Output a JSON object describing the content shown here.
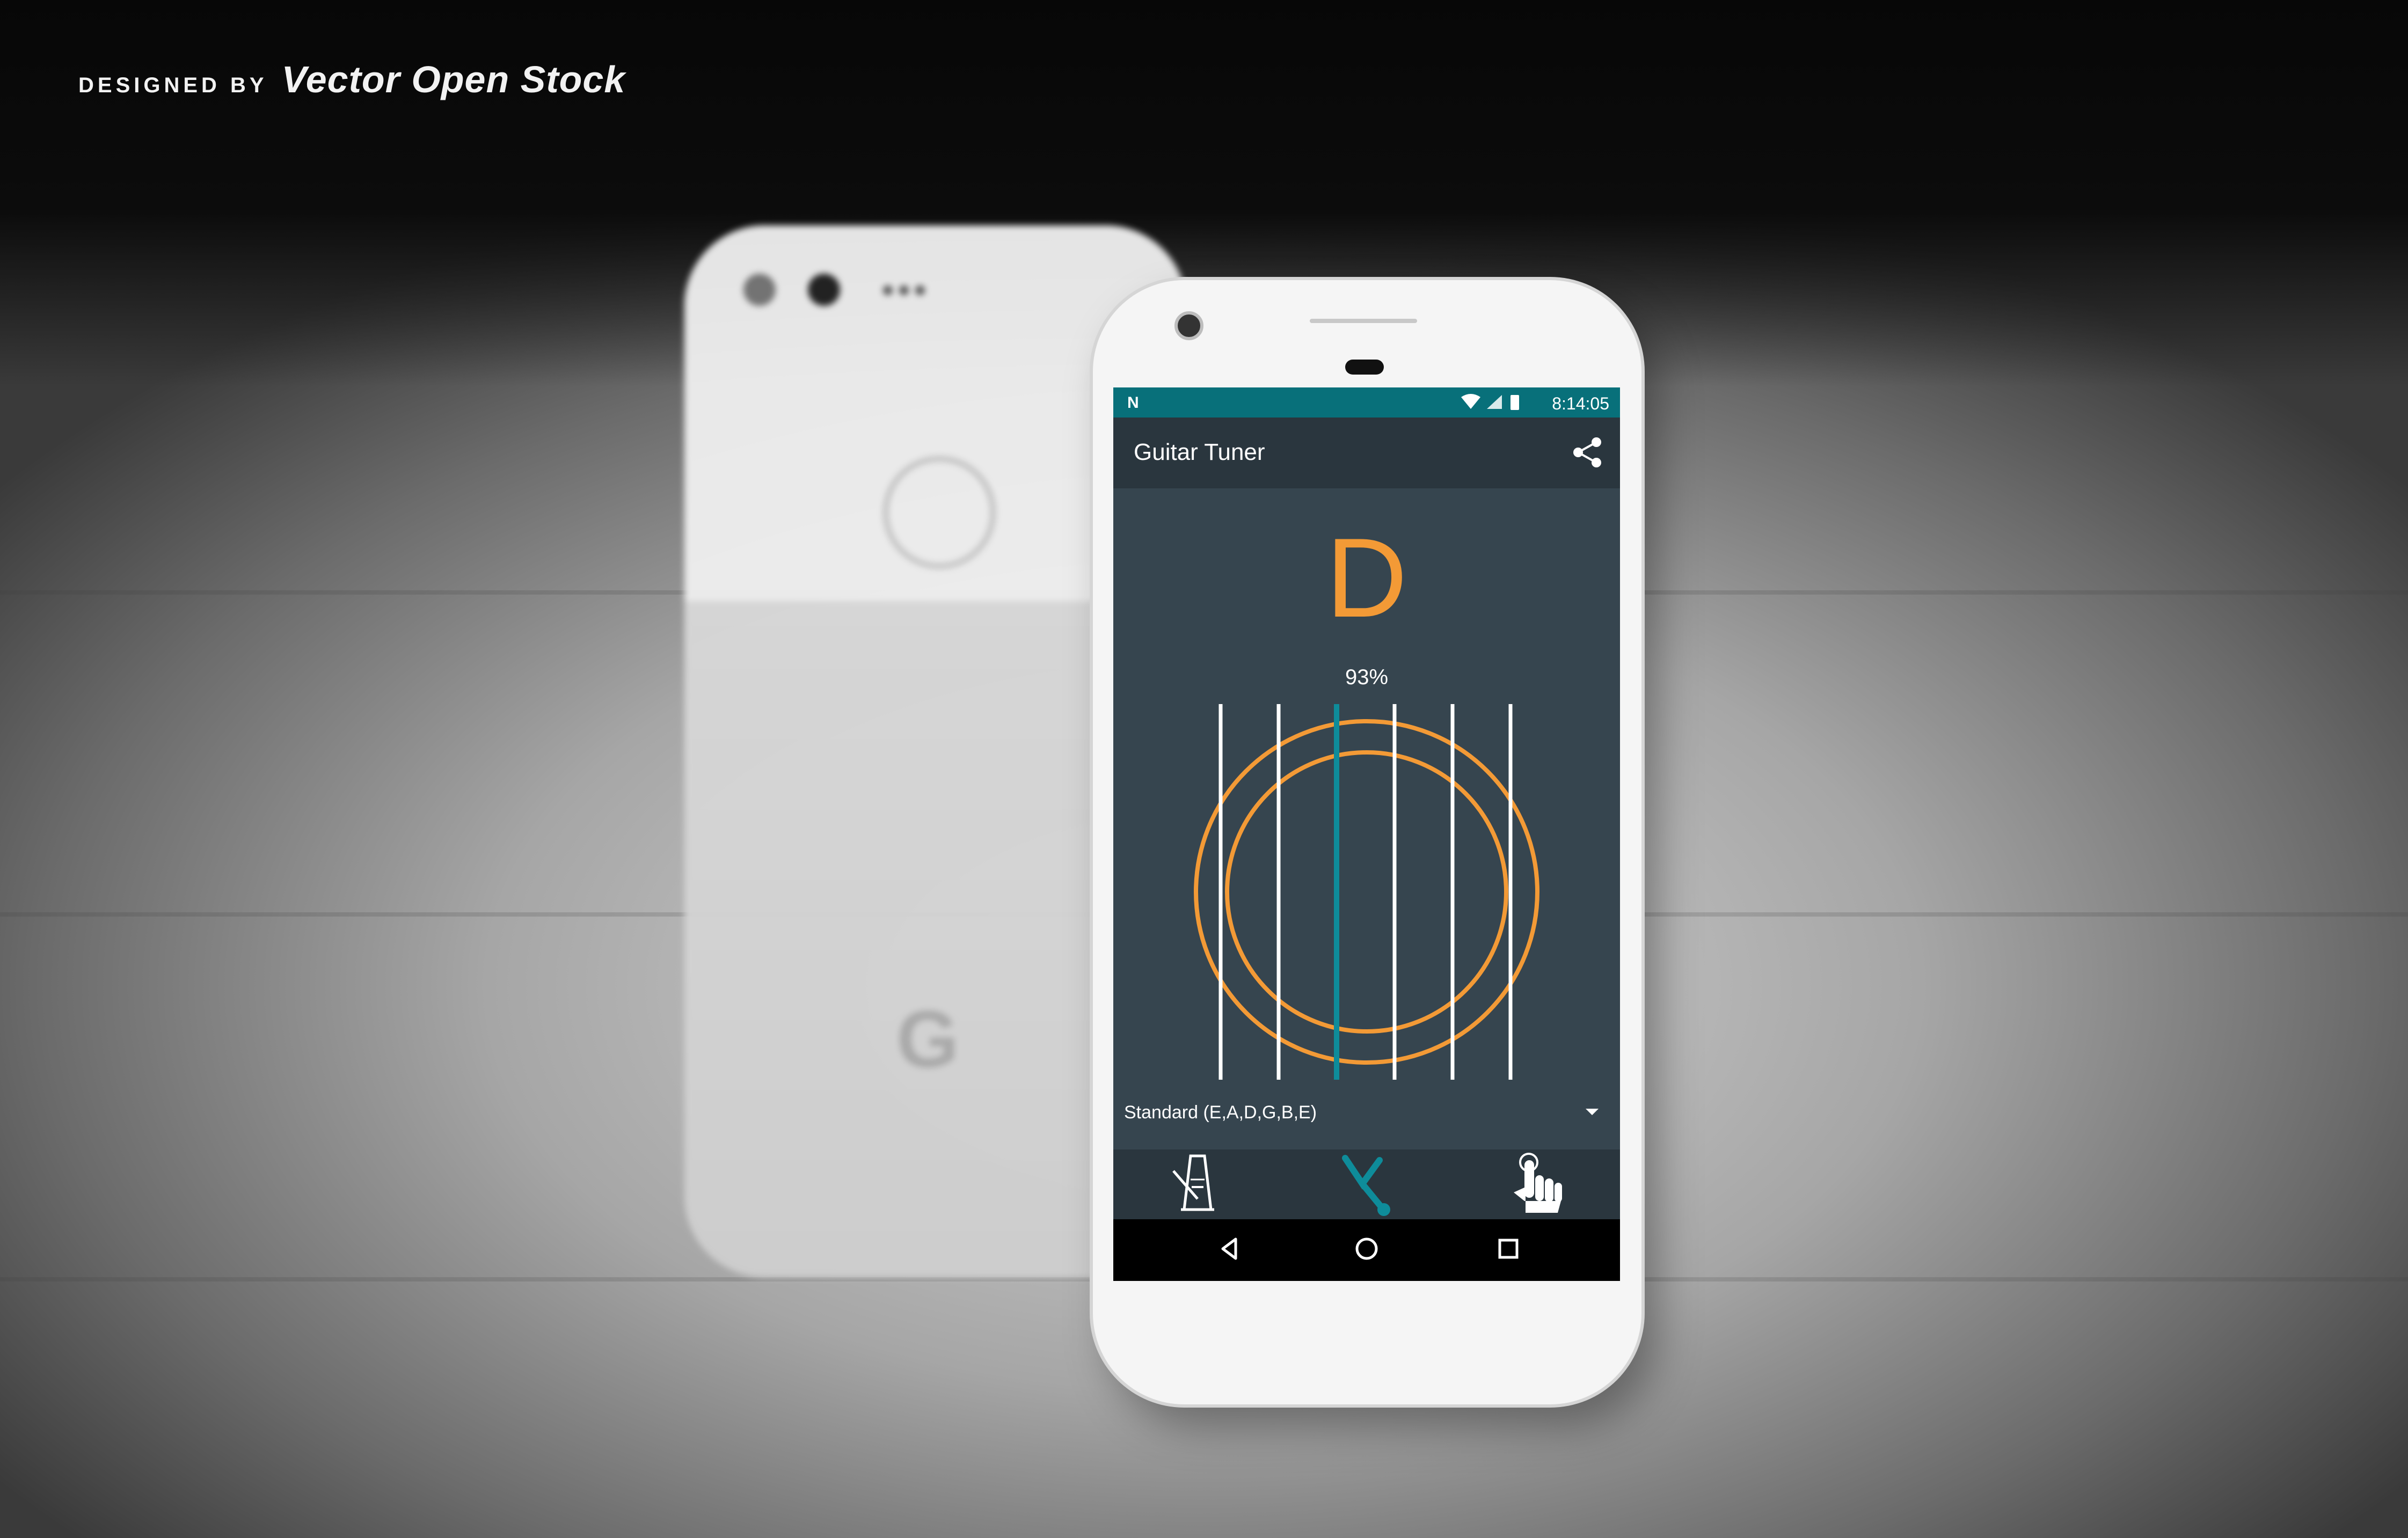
{
  "watermark": {
    "prefix": "DESIGNED BY",
    "brand": "Vector Open Stock"
  },
  "status_bar": {
    "left_icon": "n-notification-icon",
    "time": "8:14:05",
    "icons": [
      "wifi-icon",
      "signal-icon",
      "battery-icon"
    ]
  },
  "app_bar": {
    "title": "Guitar Tuner",
    "action_icon": "share-icon"
  },
  "tuner": {
    "note": "D",
    "accuracy": "93%",
    "string_count": 6,
    "active_string_index": 2,
    "colors": {
      "accent_orange": "#f39a36",
      "active_string": "#0e8c9a",
      "string": "#ffffff",
      "background": "#36454f"
    }
  },
  "tuning_select": {
    "selected": "Standard (E,A,D,G,B,E)"
  },
  "bottom_nav": {
    "items": [
      {
        "icon": "metronome-icon",
        "active": false
      },
      {
        "icon": "tuning-fork-icon",
        "active": true
      },
      {
        "icon": "tap-hand-icon",
        "active": false
      }
    ]
  },
  "system_nav": {
    "items": [
      "back-icon",
      "home-icon",
      "recents-icon"
    ]
  }
}
